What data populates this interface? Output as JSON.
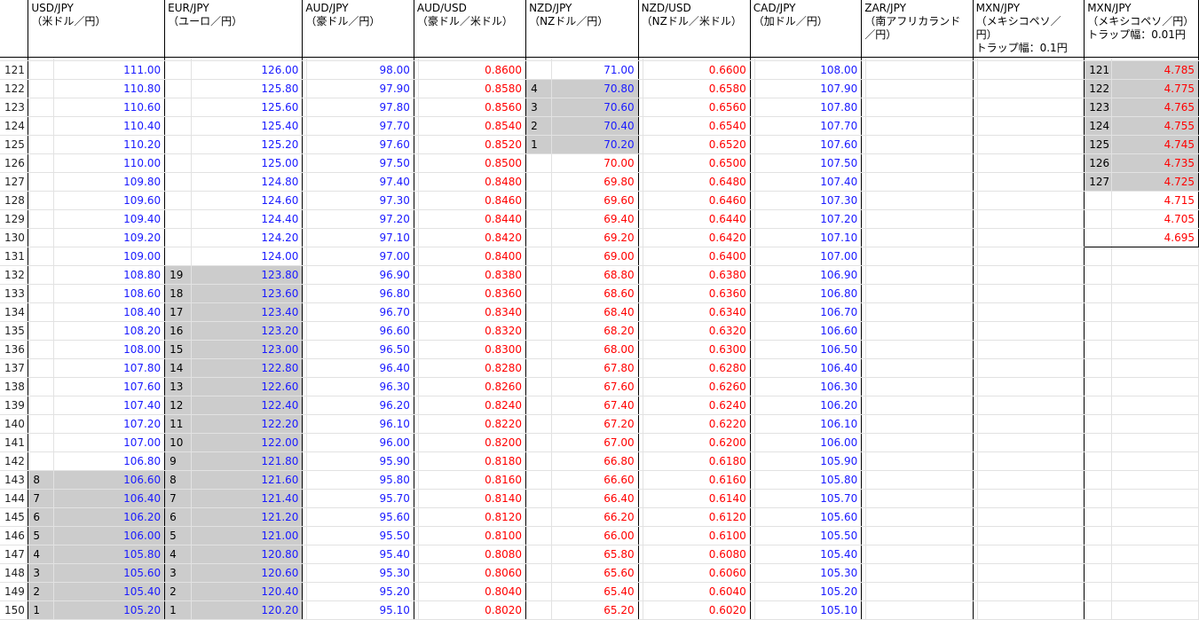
{
  "headers": [
    "",
    "USD/JPY\n（米ドル／円）",
    "",
    "EUR/JPY\n（ユーロ／円）",
    "",
    "AUD/JPY\n（豪ドル／円）",
    "",
    "AUD/USD\n（豪ドル／米ドル）",
    "",
    "NZD/JPY\n（NZドル／円）",
    "",
    "NZD/USD\n（NZドル／米ドル）",
    "",
    "CAD/JPY\n（加ドル／円）",
    "",
    "ZAR/JPY\n（南アフリカランド\n／円）",
    "",
    "MXN/JPY\n（メキシコペソ／円）\nトラップ幅：0.1円",
    "",
    "MXN/JPY\n（メキシコペソ／円）\nトラップ幅：0.01円",
    ""
  ],
  "rows": [
    {
      "r": "121",
      "usd_c": "",
      "usd": "111.00",
      "eur_c": "",
      "eur": "126.00",
      "aud": "98.00",
      "audusd": "0.8600",
      "nzd_c": "",
      "nzd": "71.00",
      "nzdusd": "0.6600",
      "cad": "108.00",
      "mxn2_c": "121",
      "mxn2": "4.785"
    },
    {
      "r": "122",
      "usd_c": "",
      "usd": "110.80",
      "eur_c": "",
      "eur": "125.80",
      "aud": "97.90",
      "audusd": "0.8580",
      "nzd_c": "4",
      "nzd": "70.80",
      "nzdusd": "0.6580",
      "cad": "107.90",
      "mxn2_c": "122",
      "mxn2": "4.775"
    },
    {
      "r": "123",
      "usd_c": "",
      "usd": "110.60",
      "eur_c": "",
      "eur": "125.60",
      "aud": "97.80",
      "audusd": "0.8560",
      "nzd_c": "3",
      "nzd": "70.60",
      "nzdusd": "0.6560",
      "cad": "107.80",
      "mxn2_c": "123",
      "mxn2": "4.765"
    },
    {
      "r": "124",
      "usd_c": "",
      "usd": "110.40",
      "eur_c": "",
      "eur": "125.40",
      "aud": "97.70",
      "audusd": "0.8540",
      "nzd_c": "2",
      "nzd": "70.40",
      "nzdusd": "0.6540",
      "cad": "107.70",
      "mxn2_c": "124",
      "mxn2": "4.755"
    },
    {
      "r": "125",
      "usd_c": "",
      "usd": "110.20",
      "eur_c": "",
      "eur": "125.20",
      "aud": "97.60",
      "audusd": "0.8520",
      "nzd_c": "1",
      "nzd": "70.20",
      "nzdusd": "0.6520",
      "cad": "107.60",
      "mxn2_c": "125",
      "mxn2": "4.745"
    },
    {
      "r": "126",
      "usd_c": "",
      "usd": "110.00",
      "eur_c": "",
      "eur": "125.00",
      "aud": "97.50",
      "audusd": "0.8500",
      "nzd_c": "",
      "nzd": "70.00",
      "nzdusd": "0.6500",
      "cad": "107.50",
      "mxn2_c": "126",
      "mxn2": "4.735"
    },
    {
      "r": "127",
      "usd_c": "",
      "usd": "109.80",
      "eur_c": "",
      "eur": "124.80",
      "aud": "97.40",
      "audusd": "0.8480",
      "nzd_c": "",
      "nzd": "69.80",
      "nzdusd": "0.6480",
      "cad": "107.40",
      "mxn2_c": "127",
      "mxn2": "4.725"
    },
    {
      "r": "128",
      "usd_c": "",
      "usd": "109.60",
      "eur_c": "",
      "eur": "124.60",
      "aud": "97.30",
      "audusd": "0.8460",
      "nzd_c": "",
      "nzd": "69.60",
      "nzdusd": "0.6460",
      "cad": "107.30",
      "mxn2_c": "",
      "mxn2": "4.715"
    },
    {
      "r": "129",
      "usd_c": "",
      "usd": "109.40",
      "eur_c": "",
      "eur": "124.40",
      "aud": "97.20",
      "audusd": "0.8440",
      "nzd_c": "",
      "nzd": "69.40",
      "nzdusd": "0.6440",
      "cad": "107.20",
      "mxn2_c": "",
      "mxn2": "4.705"
    },
    {
      "r": "130",
      "usd_c": "",
      "usd": "109.20",
      "eur_c": "",
      "eur": "124.20",
      "aud": "97.10",
      "audusd": "0.8420",
      "nzd_c": "",
      "nzd": "69.20",
      "nzdusd": "0.6420",
      "cad": "107.10",
      "mxn2_c": "",
      "mxn2": "4.695"
    },
    {
      "r": "131",
      "usd_c": "",
      "usd": "109.00",
      "eur_c": "",
      "eur": "124.00",
      "aud": "97.00",
      "audusd": "0.8400",
      "nzd_c": "",
      "nzd": "69.00",
      "nzdusd": "0.6400",
      "cad": "107.00",
      "mxn2_c": "",
      "mxn2": ""
    },
    {
      "r": "132",
      "usd_c": "",
      "usd": "108.80",
      "eur_c": "19",
      "eur": "123.80",
      "aud": "96.90",
      "audusd": "0.8380",
      "nzd_c": "",
      "nzd": "68.80",
      "nzdusd": "0.6380",
      "cad": "106.90",
      "mxn2_c": "",
      "mxn2": ""
    },
    {
      "r": "133",
      "usd_c": "",
      "usd": "108.60",
      "eur_c": "18",
      "eur": "123.60",
      "aud": "96.80",
      "audusd": "0.8360",
      "nzd_c": "",
      "nzd": "68.60",
      "nzdusd": "0.6360",
      "cad": "106.80",
      "mxn2_c": "",
      "mxn2": ""
    },
    {
      "r": "134",
      "usd_c": "",
      "usd": "108.40",
      "eur_c": "17",
      "eur": "123.40",
      "aud": "96.70",
      "audusd": "0.8340",
      "nzd_c": "",
      "nzd": "68.40",
      "nzdusd": "0.6340",
      "cad": "106.70",
      "mxn2_c": "",
      "mxn2": ""
    },
    {
      "r": "135",
      "usd_c": "",
      "usd": "108.20",
      "eur_c": "16",
      "eur": "123.20",
      "aud": "96.60",
      "audusd": "0.8320",
      "nzd_c": "",
      "nzd": "68.20",
      "nzdusd": "0.6320",
      "cad": "106.60",
      "mxn2_c": "",
      "mxn2": ""
    },
    {
      "r": "136",
      "usd_c": "",
      "usd": "108.00",
      "eur_c": "15",
      "eur": "123.00",
      "aud": "96.50",
      "audusd": "0.8300",
      "nzd_c": "",
      "nzd": "68.00",
      "nzdusd": "0.6300",
      "cad": "106.50",
      "mxn2_c": "",
      "mxn2": ""
    },
    {
      "r": "137",
      "usd_c": "",
      "usd": "107.80",
      "eur_c": "14",
      "eur": "122.80",
      "aud": "96.40",
      "audusd": "0.8280",
      "nzd_c": "",
      "nzd": "67.80",
      "nzdusd": "0.6280",
      "cad": "106.40",
      "mxn2_c": "",
      "mxn2": ""
    },
    {
      "r": "138",
      "usd_c": "",
      "usd": "107.60",
      "eur_c": "13",
      "eur": "122.60",
      "aud": "96.30",
      "audusd": "0.8260",
      "nzd_c": "",
      "nzd": "67.60",
      "nzdusd": "0.6260",
      "cad": "106.30",
      "mxn2_c": "",
      "mxn2": ""
    },
    {
      "r": "139",
      "usd_c": "",
      "usd": "107.40",
      "eur_c": "12",
      "eur": "122.40",
      "aud": "96.20",
      "audusd": "0.8240",
      "nzd_c": "",
      "nzd": "67.40",
      "nzdusd": "0.6240",
      "cad": "106.20",
      "mxn2_c": "",
      "mxn2": ""
    },
    {
      "r": "140",
      "usd_c": "",
      "usd": "107.20",
      "eur_c": "11",
      "eur": "122.20",
      "aud": "96.10",
      "audusd": "0.8220",
      "nzd_c": "",
      "nzd": "67.20",
      "nzdusd": "0.6220",
      "cad": "106.10",
      "mxn2_c": "",
      "mxn2": ""
    },
    {
      "r": "141",
      "usd_c": "",
      "usd": "107.00",
      "eur_c": "10",
      "eur": "122.00",
      "aud": "96.00",
      "audusd": "0.8200",
      "nzd_c": "",
      "nzd": "67.00",
      "nzdusd": "0.6200",
      "cad": "106.00",
      "mxn2_c": "",
      "mxn2": ""
    },
    {
      "r": "142",
      "usd_c": "",
      "usd": "106.80",
      "eur_c": "9",
      "eur": "121.80",
      "aud": "95.90",
      "audusd": "0.8180",
      "nzd_c": "",
      "nzd": "66.80",
      "nzdusd": "0.6180",
      "cad": "105.90",
      "mxn2_c": "",
      "mxn2": ""
    },
    {
      "r": "143",
      "usd_c": "8",
      "usd": "106.60",
      "eur_c": "8",
      "eur": "121.60",
      "aud": "95.80",
      "audusd": "0.8160",
      "nzd_c": "",
      "nzd": "66.60",
      "nzdusd": "0.6160",
      "cad": "105.80",
      "mxn2_c": "",
      "mxn2": ""
    },
    {
      "r": "144",
      "usd_c": "7",
      "usd": "106.40",
      "eur_c": "7",
      "eur": "121.40",
      "aud": "95.70",
      "audusd": "0.8140",
      "nzd_c": "",
      "nzd": "66.40",
      "nzdusd": "0.6140",
      "cad": "105.70",
      "mxn2_c": "",
      "mxn2": ""
    },
    {
      "r": "145",
      "usd_c": "6",
      "usd": "106.20",
      "eur_c": "6",
      "eur": "121.20",
      "aud": "95.60",
      "audusd": "0.8120",
      "nzd_c": "",
      "nzd": "66.20",
      "nzdusd": "0.6120",
      "cad": "105.60",
      "mxn2_c": "",
      "mxn2": ""
    },
    {
      "r": "146",
      "usd_c": "5",
      "usd": "106.00",
      "eur_c": "5",
      "eur": "121.00",
      "aud": "95.50",
      "audusd": "0.8100",
      "nzd_c": "",
      "nzd": "66.00",
      "nzdusd": "0.6100",
      "cad": "105.50",
      "mxn2_c": "",
      "mxn2": ""
    },
    {
      "r": "147",
      "usd_c": "4",
      "usd": "105.80",
      "eur_c": "4",
      "eur": "120.80",
      "aud": "95.40",
      "audusd": "0.8080",
      "nzd_c": "",
      "nzd": "65.80",
      "nzdusd": "0.6080",
      "cad": "105.40",
      "mxn2_c": "",
      "mxn2": ""
    },
    {
      "r": "148",
      "usd_c": "3",
      "usd": "105.60",
      "eur_c": "3",
      "eur": "120.60",
      "aud": "95.30",
      "audusd": "0.8060",
      "nzd_c": "",
      "nzd": "65.60",
      "nzdusd": "0.6060",
      "cad": "105.30",
      "mxn2_c": "",
      "mxn2": ""
    },
    {
      "r": "149",
      "usd_c": "2",
      "usd": "105.40",
      "eur_c": "2",
      "eur": "120.40",
      "aud": "95.20",
      "audusd": "0.8040",
      "nzd_c": "",
      "nzd": "65.40",
      "nzdusd": "0.6040",
      "cad": "105.20",
      "mxn2_c": "",
      "mxn2": ""
    },
    {
      "r": "150",
      "usd_c": "1",
      "usd": "105.20",
      "eur_c": "1",
      "eur": "120.20",
      "aud": "95.10",
      "audusd": "0.8020",
      "nzd_c": "",
      "nzd": "65.20",
      "nzdusd": "0.6020",
      "cad": "105.10",
      "mxn2_c": "",
      "mxn2": ""
    }
  ],
  "highlight": {
    "usd_from": "143",
    "usd_to": "150",
    "eur_from": "132",
    "eur_to": "150",
    "nzd_from": "122",
    "nzd_to": "125",
    "mxn2_from": "121",
    "mxn2_to": "127"
  },
  "colors": {
    "jpy_value": "#1a1aff",
    "usd_value": "#ff0000",
    "highlight": "#cccccc"
  }
}
